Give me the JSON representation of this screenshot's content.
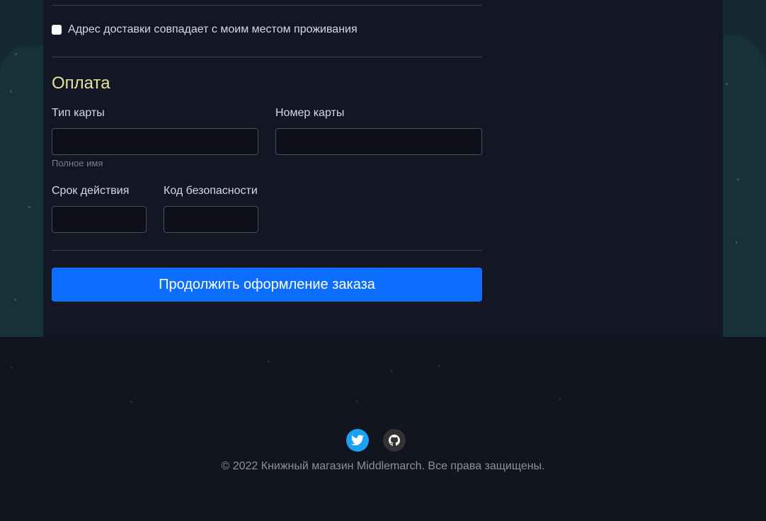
{
  "shipping_checkbox": {
    "label": "Адрес доставки совпадает с моим местом проживания",
    "checked": false
  },
  "payment": {
    "title": "Оплата",
    "card_type_label": "Тип карты",
    "card_number_label": "Номер карты",
    "card_type_hint": "Полное имя",
    "expiry_label": "Срок действия",
    "security_code_label": "Код безопасности",
    "card_type_value": "",
    "card_number_value": "",
    "expiry_value": "",
    "security_code_value": ""
  },
  "continue_button": "Продолжить оформление заказа",
  "footer": {
    "social": [
      "twitter-icon",
      "github-icon"
    ],
    "copyright": "© 2022 Книжный магазин Middlemarch. Все права защищены."
  },
  "colors": {
    "accent": "#0d6efd",
    "heading": "#e8e39a",
    "twitter": "#1da1f2",
    "github": "#333333"
  }
}
